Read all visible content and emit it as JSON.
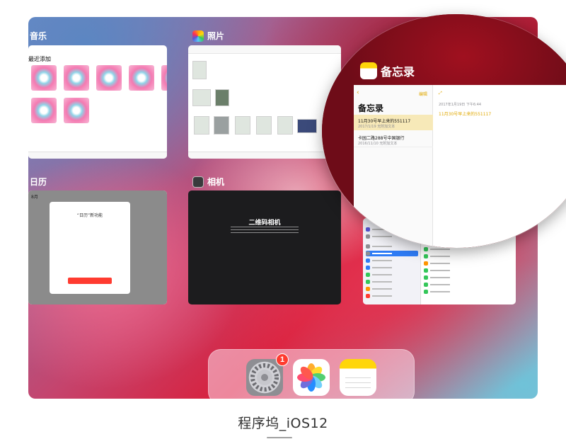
{
  "apps": {
    "music": {
      "label": "音乐",
      "section": "最近添加"
    },
    "photos": {
      "label": "照片"
    },
    "calendar": {
      "label": "日历",
      "month_stub": "8月",
      "dialog_title": "“日历”新功能"
    },
    "camera": {
      "label": "相机",
      "title": "二维码相机"
    },
    "notes": {
      "label": "备忘录",
      "back_label": "编辑",
      "list_title": "备忘录",
      "header_date": "2017年1月19日 下午6:44",
      "items": [
        {
          "title": "11月30号早上来的551117",
          "sub": "2017/1/19   无附加文本"
        },
        {
          "title": "卡园二路288号中国银行",
          "sub": "2016/11/10   无附加文本"
        }
      ],
      "body_text": "11月30号早上来的551117"
    }
  },
  "dock": {
    "settings_badge": "1",
    "apps": [
      "settings-app-icon",
      "photos-app-icon",
      "notes-app-icon"
    ]
  },
  "caption": "程序坞_iOS12",
  "colors": {
    "accent_blue": "#2f7cf6",
    "notes_yellow": "#ffd60a",
    "badge_red": "#ff3b30"
  }
}
